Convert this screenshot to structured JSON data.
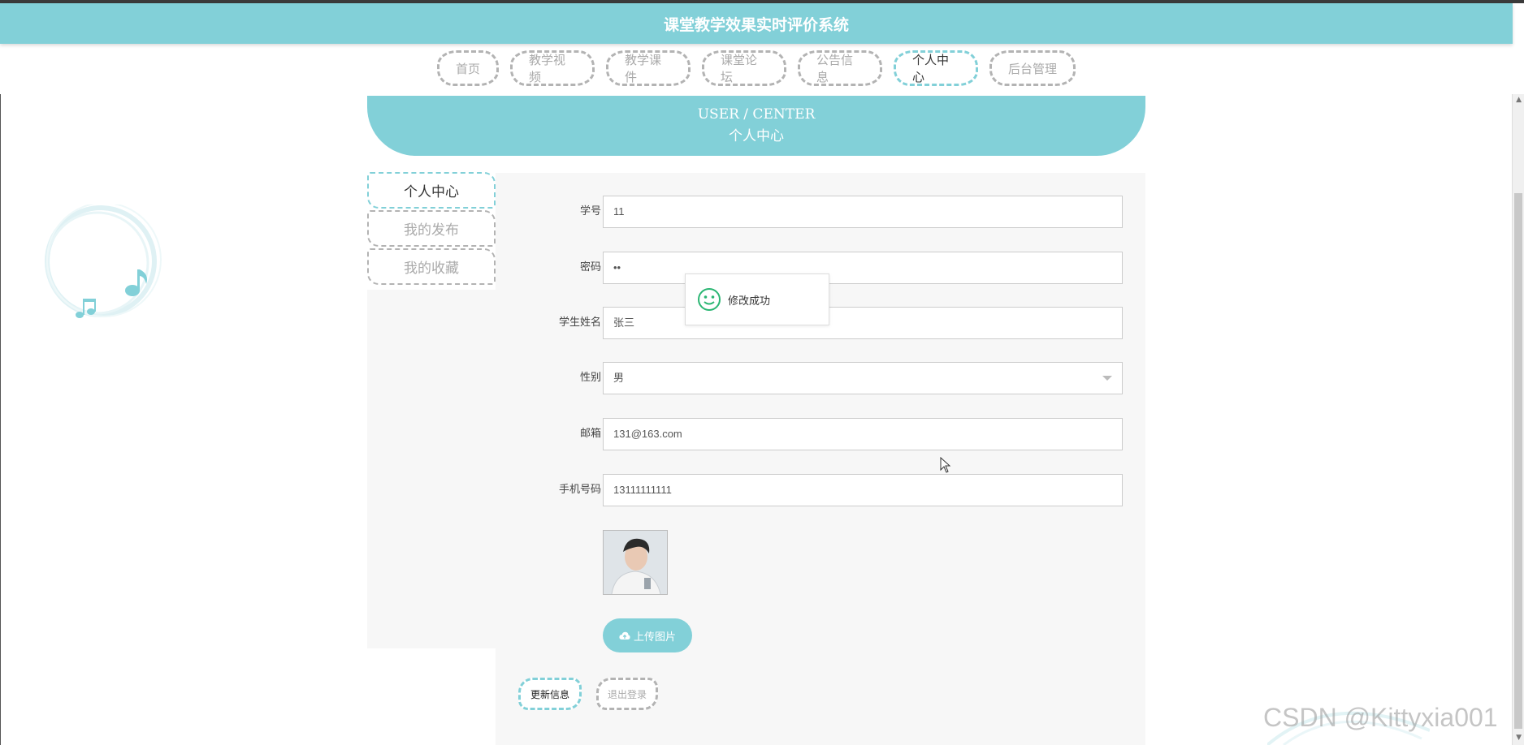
{
  "header": {
    "title": "课堂教学效果实时评价系统"
  },
  "nav": {
    "items": [
      {
        "label": "首页"
      },
      {
        "label": "教学视频"
      },
      {
        "label": "教学课件"
      },
      {
        "label": "课堂论坛"
      },
      {
        "label": "公告信息"
      },
      {
        "label": "个人中心",
        "active": true
      },
      {
        "label": "后台管理"
      }
    ]
  },
  "banner": {
    "title_en": "USER / CENTER",
    "title_cn": "个人中心"
  },
  "sidebar": {
    "items": [
      {
        "label": "个人中心",
        "active": true
      },
      {
        "label": "我的发布"
      },
      {
        "label": "我的收藏"
      }
    ]
  },
  "form": {
    "student_id": {
      "label": "学号",
      "value": "11"
    },
    "password": {
      "label": "密码",
      "value": "••"
    },
    "name": {
      "label": "学生姓名",
      "value": "张三"
    },
    "gender": {
      "label": "性别",
      "value": "男"
    },
    "email": {
      "label": "邮箱",
      "value": "131@163.com"
    },
    "phone": {
      "label": "手机号码",
      "value": "13111111111"
    }
  },
  "upload": {
    "label": "上传图片",
    "icon": "cloud-upload-icon"
  },
  "actions": {
    "update_label": "更新信息",
    "logout_label": "退出登录"
  },
  "toast": {
    "message": "修改成功",
    "icon": "smile-icon"
  },
  "watermark": "CSDN @Kittyxia001",
  "colors": {
    "accent": "#82d0d8",
    "dashed_inactive": "#b3b3b3",
    "panel_bg": "#f7f7f7"
  }
}
